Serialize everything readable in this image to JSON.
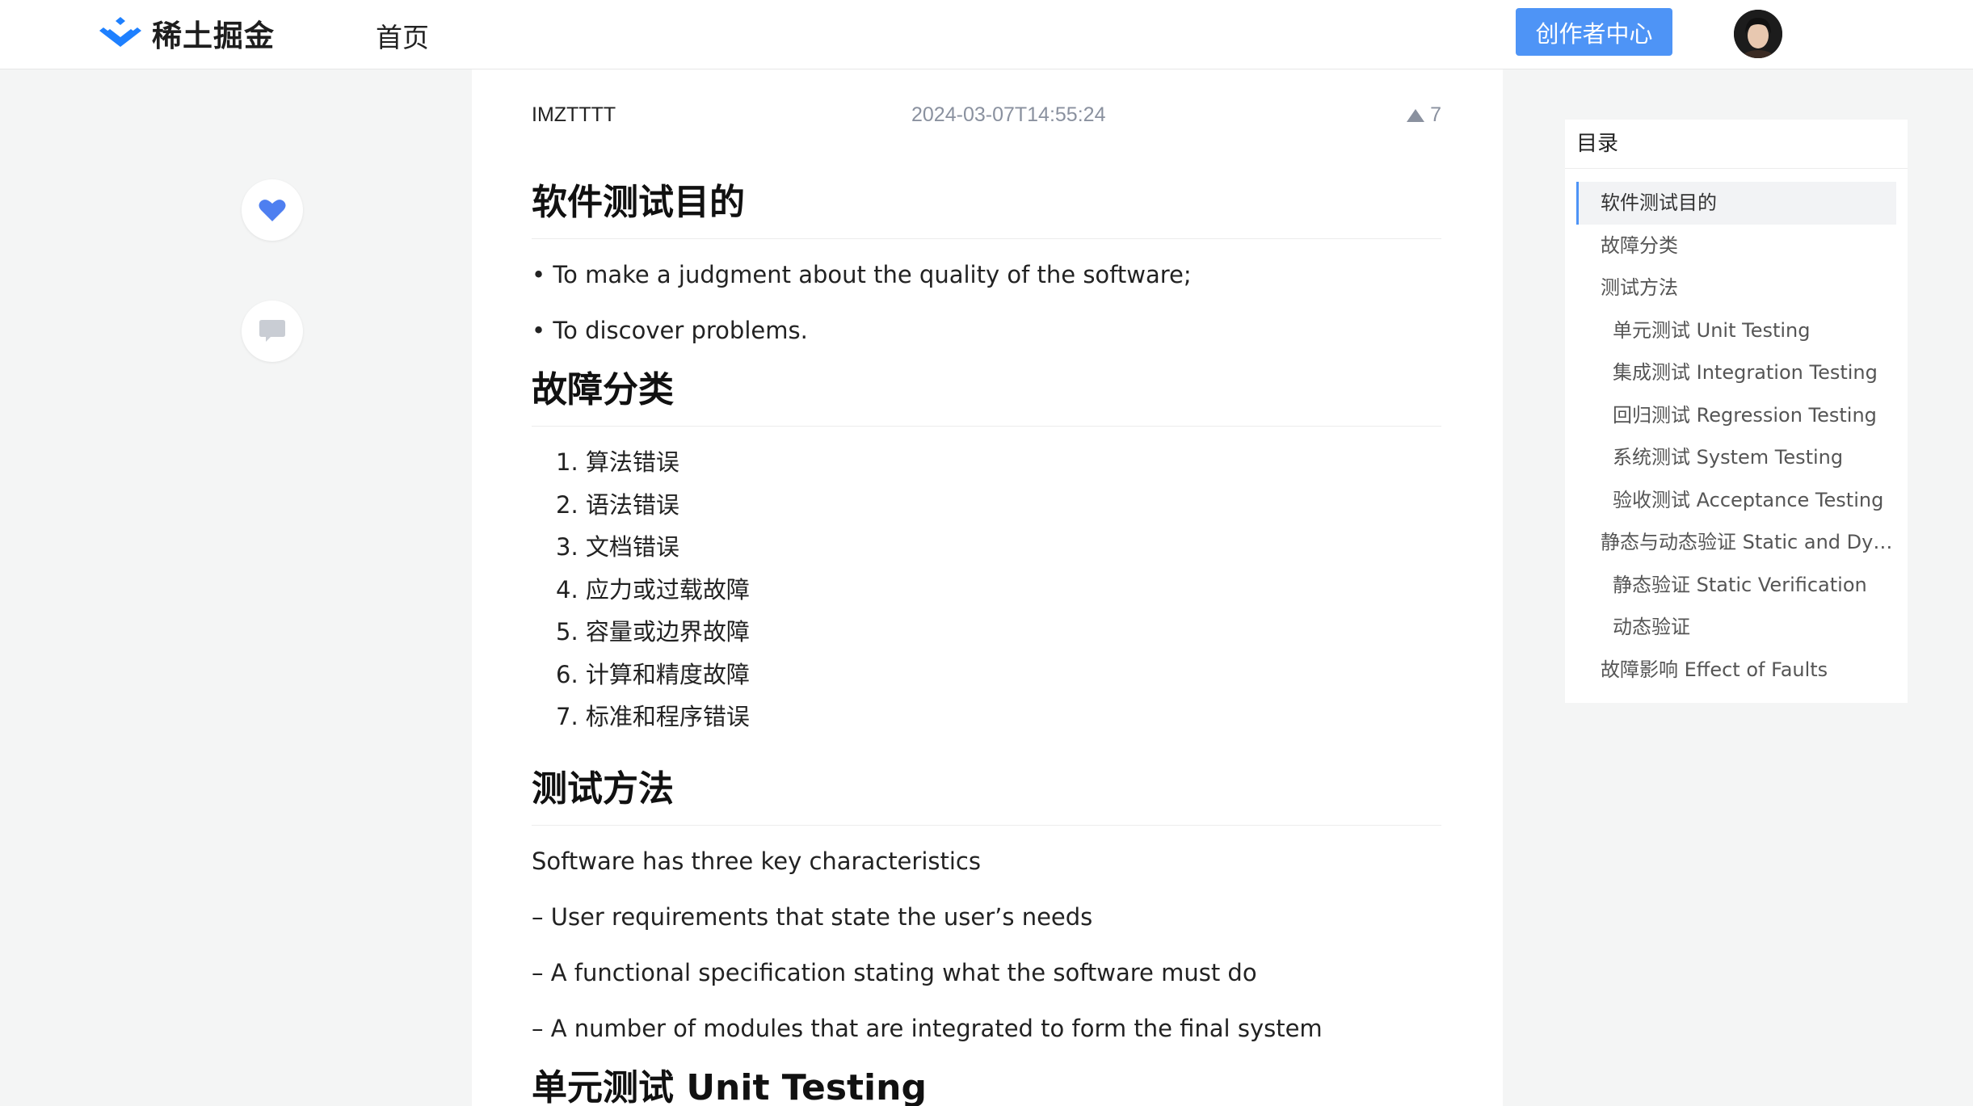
{
  "header": {
    "logo_text": "稀土掘金",
    "nav_home": "首页",
    "creator_button": "创作者中心"
  },
  "article": {
    "author": "IMZTTTT",
    "date": "2024-03-07T14:55:24",
    "votes": "7",
    "sections": {
      "purpose": {
        "heading": "软件测试目的",
        "p1": "• To make a judgment about the quality of the software;",
        "p2": "• To discover problems."
      },
      "faults": {
        "heading": "故障分类",
        "items": [
          "1. 算法错误",
          "2. 语法错误",
          "3. 文档错误",
          "4. 应力或过载故障",
          "5. 容量或边界故障",
          "6. 计算和精度故障",
          "7. 标准和程序错误"
        ]
      },
      "methods": {
        "heading": "测试方法",
        "p1": "Software has three key characteristics",
        "p2": "– User requirements that state the user’s needs",
        "p3": "– A functional specification stating what the software must do",
        "p4": "– A number of modules that are integrated to form the final system",
        "next_heading": "单元测试 Unit Testing"
      }
    }
  },
  "toc": {
    "title": "目录",
    "items": [
      {
        "label": "软件测试目的",
        "level": 1,
        "active": true
      },
      {
        "label": "故障分类",
        "level": 1
      },
      {
        "label": "测试方法",
        "level": 1
      },
      {
        "label": "单元测试 Unit Testing",
        "level": 2
      },
      {
        "label": "集成测试 Integration Testing",
        "level": 2
      },
      {
        "label": "回归测试 Regression Testing",
        "level": 2
      },
      {
        "label": "系统测试 System Testing",
        "level": 2
      },
      {
        "label": "验收测试 Acceptance Testing",
        "level": 2
      },
      {
        "label": "静态与动态验证 Static and Dyn...",
        "level": 1
      },
      {
        "label": "静态验证 Static Verification",
        "level": 2
      },
      {
        "label": "动态验证",
        "level": 2
      },
      {
        "label": "故障影响 Effect of Faults",
        "level": 1
      }
    ]
  },
  "colors": {
    "accent": "#4e94f6",
    "like_icon": "#4e7ff0",
    "muted_text": "#8a919f",
    "page_bg": "#f4f5f5"
  },
  "icons": [
    "juejin-logo-icon",
    "heart-icon",
    "comment-icon",
    "upvote-triangle-icon"
  ]
}
